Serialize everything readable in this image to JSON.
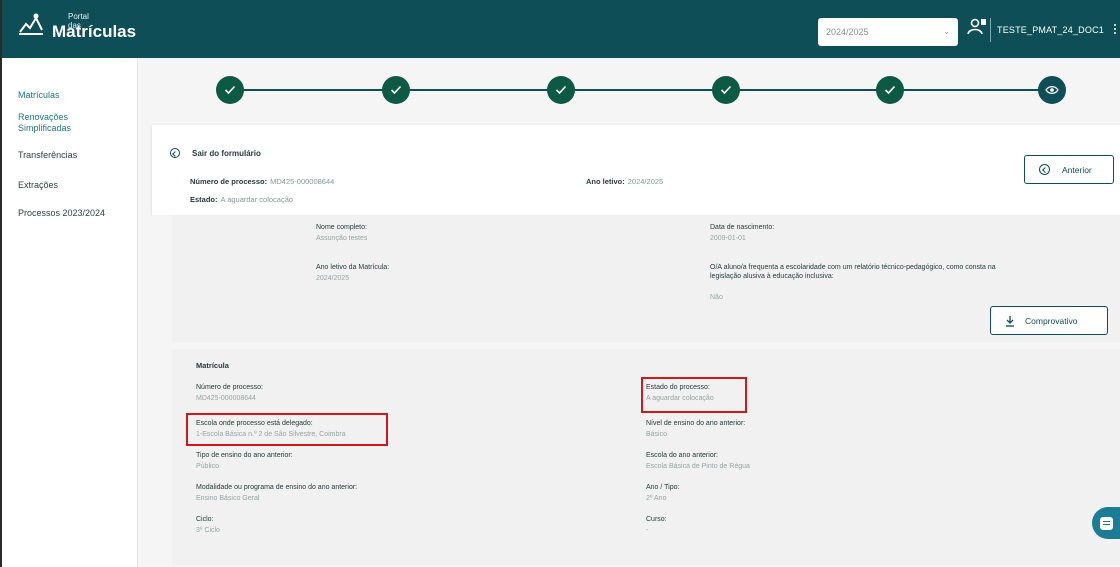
{
  "header": {
    "logo_small": "Portal das",
    "logo_big": "Matrículas",
    "year_selected": "2024/2025",
    "user_name": "TESTE_PMAT_24_DOC1"
  },
  "sidebar": {
    "items": [
      {
        "label": "Matrículas"
      },
      {
        "label": "Renovações Simplificadas"
      },
      {
        "label": "Transferências"
      },
      {
        "label": "Extrações"
      },
      {
        "label": "Processos 2023/2024"
      }
    ]
  },
  "stepper": {
    "steps": [
      {
        "state": "done",
        "icon": "check-icon"
      },
      {
        "state": "done",
        "icon": "check-icon"
      },
      {
        "state": "done",
        "icon": "check-icon"
      },
      {
        "state": "done",
        "icon": "check-icon"
      },
      {
        "state": "done",
        "icon": "check-icon"
      },
      {
        "state": "current",
        "icon": "eye-icon"
      }
    ]
  },
  "panel": {
    "exit_label": "Sair do formulário",
    "process_number_label": "Número de processo:",
    "process_number_value": "MD425-000008644",
    "school_year_label": "Ano letivo:",
    "school_year_value": "2024/2025",
    "state_label": "Estado:",
    "state_value": "A aguardar colocação",
    "anterior_button": "Anterior"
  },
  "student": {
    "full_name_label": "Nome completo:",
    "full_name_value": "Assunção testes",
    "birth_date_label": "Data de nascimento:",
    "birth_date_value": "2009-01-01",
    "enroll_year_label": "Ano letivo da Matrícula:",
    "enroll_year_value": "2024/2025",
    "inclusive_question": "O/A aluno/a frequenta a escolaridade com um relatório técnico-pedagógico, como consta na legislação alusiva à educação inclusiva:",
    "inclusive_value": "Não",
    "comprovativo_button": "Comprovativo"
  },
  "matricula": {
    "title": "Matrícula",
    "process_number_label": "Número de processo:",
    "process_number_value": "MD425-000008644",
    "process_state_label": "Estado do processo:",
    "process_state_value": "A aguardar colocação",
    "delegated_school_label": "Escola onde processo está delegado:",
    "delegated_school_value": "1-Escola Básica n.º 2 de São Silvestre, Coimbra",
    "prev_level_label": "Nível de ensino do ano anterior:",
    "prev_level_value": "Básico",
    "prev_type_label": "Tipo de ensino do ano anterior:",
    "prev_type_value": "Público",
    "prev_school_label": "Escola do ano anterior:",
    "prev_school_value": "Escola Básica de Pinto de Régua",
    "prev_modality_label": "Modalidade ou programa de ensino do ano anterior:",
    "prev_modality_value": "Ensino Básico Geral",
    "year_type_label": "Ano / Tipo:",
    "year_type_value": "2º Ano",
    "cycle_label": "Ciclo:",
    "cycle_value": "3º Ciclo",
    "course_label": "Curso:",
    "course_value": "-"
  }
}
